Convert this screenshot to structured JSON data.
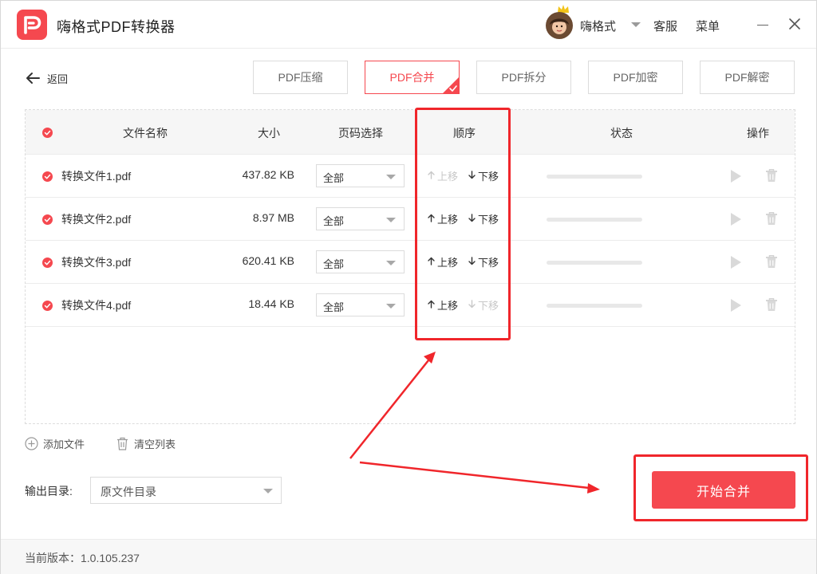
{
  "app": {
    "title": "嗨格式PDF转换器"
  },
  "user": {
    "name": "嗨格式"
  },
  "header": {
    "service": "客服",
    "menu": "菜单"
  },
  "nav": {
    "back_label": "返回"
  },
  "tabs": [
    {
      "label": "PDF压缩",
      "active": false
    },
    {
      "label": "PDF合并",
      "active": true
    },
    {
      "label": "PDF拆分",
      "active": false
    },
    {
      "label": "PDF加密",
      "active": false
    },
    {
      "label": "PDF解密",
      "active": false
    }
  ],
  "table": {
    "headers": {
      "name": "文件名称",
      "size": "大小",
      "pages": "页码选择",
      "order": "顺序",
      "status": "状态",
      "actions": "操作"
    },
    "rows": [
      {
        "name": "转换文件1.pdf",
        "size": "437.82 KB",
        "pages": "全部",
        "up_label": "上移",
        "down_label": "下移",
        "up_enabled": false,
        "down_enabled": true,
        "progress": 0
      },
      {
        "name": "转换文件2.pdf",
        "size": "8.97 MB",
        "pages": "全部",
        "up_label": "上移",
        "down_label": "下移",
        "up_enabled": true,
        "down_enabled": true,
        "progress": 0
      },
      {
        "name": "转换文件3.pdf",
        "size": "620.41 KB",
        "pages": "全部",
        "up_label": "上移",
        "down_label": "下移",
        "up_enabled": true,
        "down_enabled": true,
        "progress": 0
      },
      {
        "name": "转换文件4.pdf",
        "size": "18.44 KB",
        "pages": "全部",
        "up_label": "上移",
        "down_label": "下移",
        "up_enabled": true,
        "down_enabled": false,
        "progress": 0
      }
    ]
  },
  "actions": {
    "add_file": "添加文件",
    "clear_list": "清空列表"
  },
  "output": {
    "label": "输出目录:",
    "value": "原文件目录"
  },
  "start_button": "开始合并",
  "footer": {
    "version": "当前版本：1.0.105.237"
  },
  "colors": {
    "accent": "#f5484f",
    "annotation": "#f0262b",
    "disabled": "#c8c8c8"
  },
  "icons": {
    "logo": "app-logo-icon",
    "back": "arrow-left-icon",
    "check": "check-circle-icon",
    "up": "arrow-up-icon",
    "down": "arrow-down-icon",
    "play": "play-icon",
    "trash": "trash-icon",
    "add": "plus-circle-icon",
    "clear": "trash-icon",
    "close": "close-icon",
    "minimize": "minimize-icon"
  }
}
